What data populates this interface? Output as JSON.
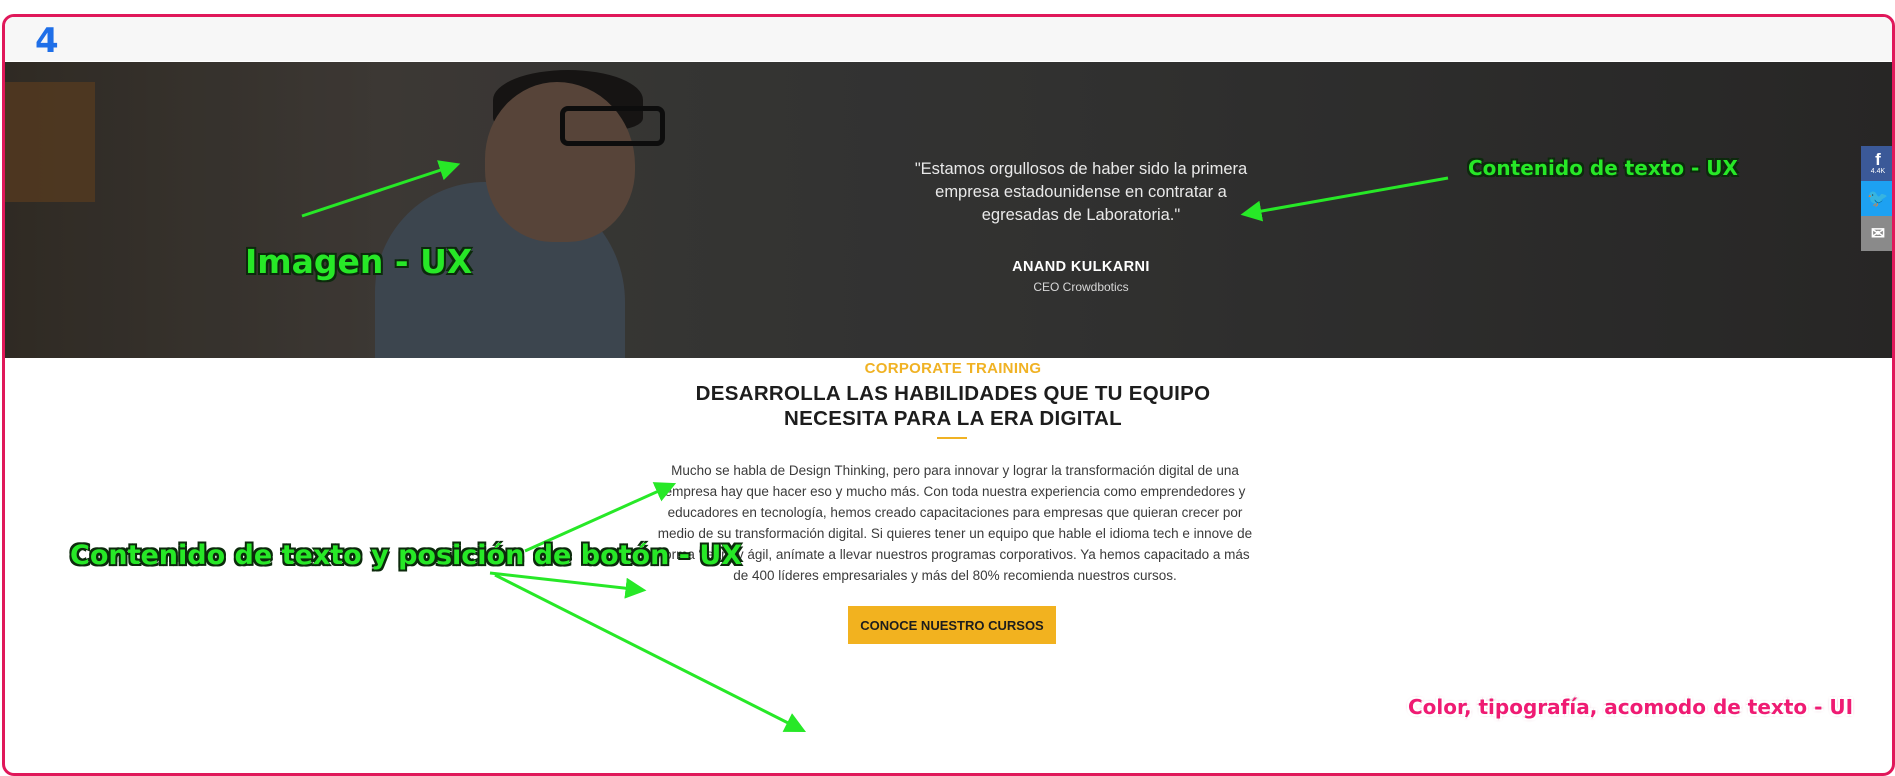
{
  "annotations": {
    "step_number": "4",
    "image_label": "Imagen - UX",
    "text_content_label": "Contenido de texto - UX",
    "text_button_label": "Contenido de texto y posición de botón - UX",
    "ui_label": "Color, tipografía, acomodo de texto - UI",
    "colors": {
      "ux": "#27e827",
      "ui": "#ef1b73",
      "frame": "#e0185a",
      "step": "#1f6fe8"
    }
  },
  "testimonial": {
    "quote": "\"Estamos orgullosos de haber sido la primera empresa estadounidense en contratar a egresadas de Laboratoria.\"",
    "author": "ANAND KULKARNI",
    "role": "CEO Crowdbotics"
  },
  "corporate": {
    "eyebrow": "CORPORATE TRAINING",
    "heading": "DESARROLLA LAS HABILIDADES QUE TU EQUIPO NECESITA PARA LA ERA DIGITAL",
    "body": "Mucho se habla de Design Thinking, pero para innovar y lograr la transformación digital de una empresa hay que hacer eso y mucho más. Con toda nuestra experiencia como emprendedores y educadores en tecnología, hemos creado capacitaciones para empresas que quieran crecer por medio de su transformación digital. Si quieres tener un equipo que hable el idioma tech e innove de forma “lean” y ágil, anímate a llevar nuestros programas corporativos. Ya hemos capacitado a más de 400 líderes empresariales y más del 80% recomienda nuestros cursos.",
    "cta_label": "CONOCE NUESTRO CURSOS",
    "accent_color": "#f2b21f"
  },
  "share": {
    "facebook_icon": "facebook-icon",
    "facebook_glyph": "f",
    "facebook_count": "4.4K",
    "twitter_icon": "twitter-bird-icon",
    "twitter_glyph": "🐦",
    "email_icon": "envelope-icon",
    "email_glyph": "✉"
  }
}
